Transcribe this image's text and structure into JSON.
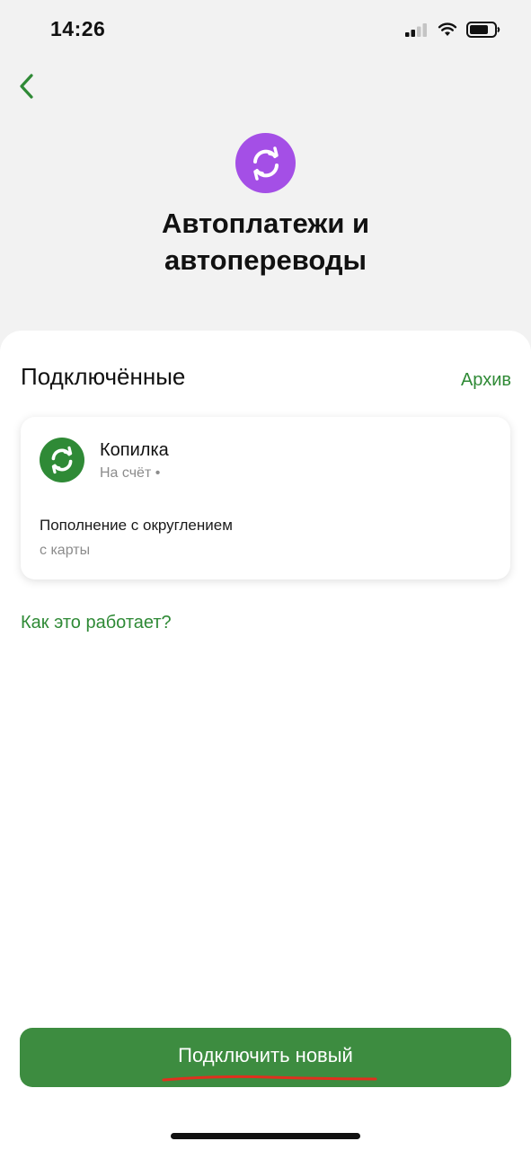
{
  "status_bar": {
    "time": "14:26"
  },
  "header": {
    "title": "Автоплатежи и автопереводы"
  },
  "section": {
    "title": "Подключённые",
    "archive_label": "Архив"
  },
  "autopay_card": {
    "title": "Копилка",
    "subtitle": "На счёт •",
    "description": "Пополнение с округлением",
    "source": "с карты"
  },
  "help_link": "Как это работает?",
  "primary_button": {
    "label": "Подключить новый"
  },
  "colors": {
    "accent_green": "#2f8a36",
    "button_green": "#3d8c40",
    "hero_purple": "#a44fe6",
    "underline_red": "#e0301e"
  },
  "icons": [
    "back-chevron-icon",
    "refresh-icon",
    "signal-icon",
    "wifi-icon",
    "battery-icon"
  ]
}
